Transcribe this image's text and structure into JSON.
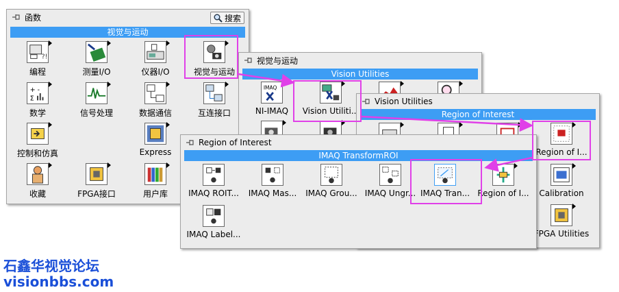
{
  "colors": {
    "accent_bar": "#3d9df4",
    "highlight": "#e040e8",
    "watermark": "#1a4fd8"
  },
  "functions_palette": {
    "title": "函数",
    "search_label": "搜索",
    "category": "视觉与运动",
    "items": [
      {
        "label": "编程",
        "icon": "programming-icon"
      },
      {
        "label": "测量I/O",
        "icon": "measurement-io-icon"
      },
      {
        "label": "仪器I/O",
        "icon": "instrument-io-icon"
      },
      {
        "label": "视觉与运动",
        "icon": "vision-motion-icon"
      },
      {
        "label": "数学",
        "icon": "math-icon"
      },
      {
        "label": "信号处理",
        "icon": "signal-processing-icon"
      },
      {
        "label": "数据通信",
        "icon": "data-communication-icon"
      },
      {
        "label": "互连接口",
        "icon": "connectivity-icon"
      },
      {
        "label": "控制和仿真",
        "icon": "control-simulation-icon"
      },
      {
        "label": "Express",
        "icon": "express-icon"
      },
      {
        "label": "收藏",
        "icon": "favorites-icon"
      },
      {
        "label": "FPGA接口",
        "icon": "fpga-interface-icon"
      },
      {
        "label": "用户库",
        "icon": "user-library-icon"
      }
    ]
  },
  "vision_motion_palette": {
    "title": "视觉与运动",
    "category": "Vision Utilities",
    "items": [
      {
        "label": "NI-IMAQ",
        "icon": "ni-imaq-icon"
      },
      {
        "label": "Vision Utiliti...",
        "icon": "vision-utilities-icon"
      }
    ]
  },
  "vision_utilities_palette": {
    "title": "Vision Utilities",
    "category": "Region of Interest",
    "items": [
      {
        "label": "Region of I...",
        "icon": "region-of-interest-icon"
      },
      {
        "label": "Calibration",
        "icon": "calibration-icon"
      },
      {
        "label": "FPGA Utilities",
        "icon": "fpga-utilities-icon"
      }
    ]
  },
  "roi_palette": {
    "title": "Region of Interest",
    "category": "IMAQ TransformROI",
    "items": [
      {
        "label": "IMAQ ROIT...",
        "icon": "imaq-roi-icon"
      },
      {
        "label": "IMAQ Mas...",
        "icon": "imaq-mask-icon"
      },
      {
        "label": "IMAQ Grou...",
        "icon": "imaq-group-icon"
      },
      {
        "label": "IMAQ Ungr...",
        "icon": "imaq-ungroup-icon"
      },
      {
        "label": "IMAQ Tran...",
        "icon": "imaq-transform-roi-icon"
      },
      {
        "label": "Region of I...",
        "icon": "region-of-interest-sub-icon"
      },
      {
        "label": "IMAQ Label...",
        "icon": "imaq-label-icon"
      }
    ]
  },
  "watermark": {
    "line1": "石鑫华视觉论坛",
    "line2": "visionbbs.com"
  }
}
